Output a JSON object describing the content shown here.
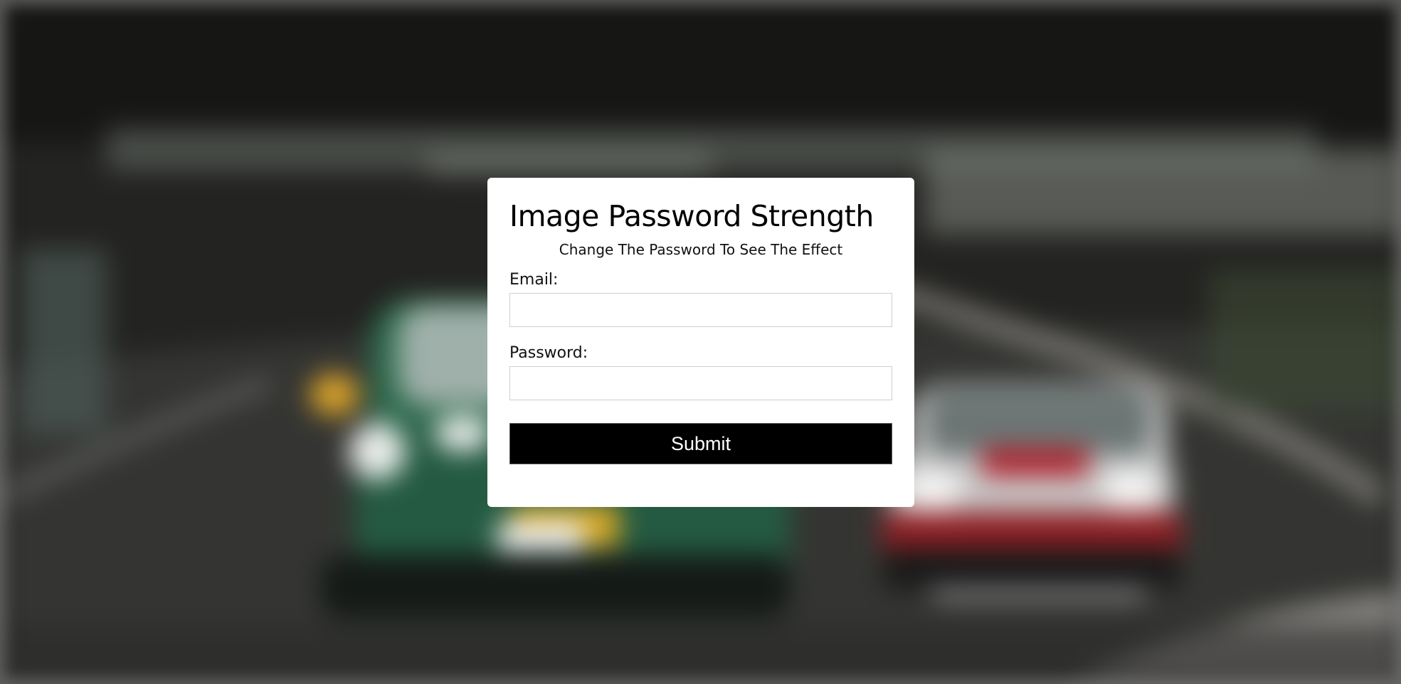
{
  "form": {
    "title": "Image Password Strength",
    "subtitle": "Change The Password To See The Effect",
    "email_label": "Email:",
    "email_value": "",
    "password_label": "Password:",
    "password_value": "",
    "submit_label": "Submit"
  },
  "background": {
    "description_icon": "blurred-race-cars-image",
    "accent": "#000000",
    "card_color": "#ffffff"
  }
}
